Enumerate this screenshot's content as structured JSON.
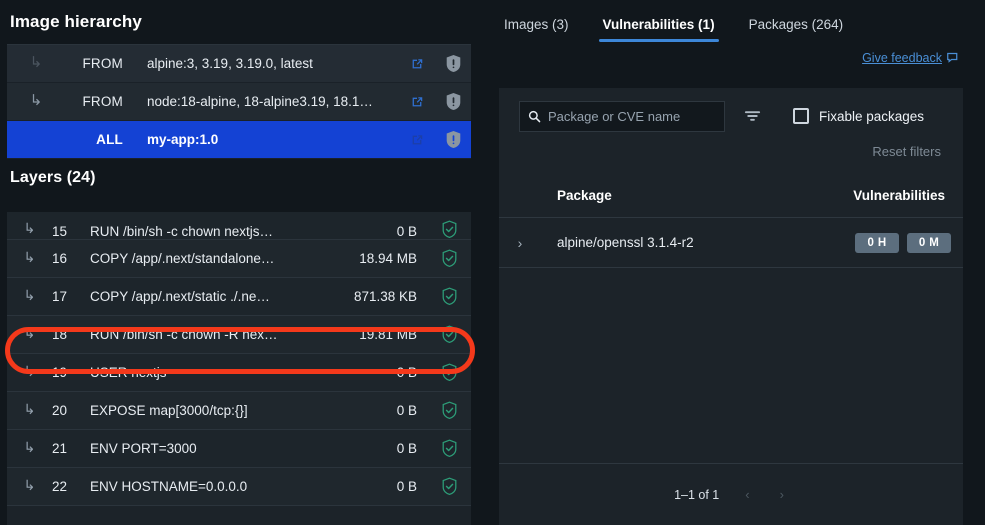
{
  "left": {
    "hierarchy_title": "Image hierarchy",
    "hierarchy_rows": [
      {
        "arrow": "corner-arrow",
        "keyword": "FROM",
        "name": "alpine:3, 3.19, 3.19.0, latest",
        "link_icon": "external-link-icon",
        "status_icon": "shield-warning-icon",
        "selected": false
      },
      {
        "arrow": "corner-arrow",
        "keyword": "FROM",
        "name": "node:18-alpine, 18-alpine3.19, 18.1…",
        "link_icon": "external-link-icon",
        "status_icon": "shield-warning-icon",
        "selected": false
      },
      {
        "arrow": "",
        "keyword": "ALL",
        "name": "my-app:1.0",
        "link_icon": "external-link-icon",
        "status_icon": "shield-warning-icon",
        "selected": true
      }
    ],
    "layers_title": "Layers (24)",
    "layers": [
      {
        "num": "15",
        "command": "RUN /bin/sh -c chown nextjs…",
        "size": "0 B",
        "status_icon": "shield-check-icon"
      },
      {
        "num": "16",
        "command": "COPY /app/.next/standalone…",
        "size": "18.94 MB",
        "status_icon": "shield-check-icon"
      },
      {
        "num": "17",
        "command": "COPY /app/.next/static ./.ne…",
        "size": "871.38 KB",
        "status_icon": "shield-check-icon"
      },
      {
        "num": "18",
        "command": "RUN /bin/sh -c chown -R nex…",
        "size": "19.81 MB",
        "status_icon": "shield-check-icon"
      },
      {
        "num": "19",
        "command": "USER nextjs",
        "size": "0 B",
        "status_icon": "shield-check-icon"
      },
      {
        "num": "20",
        "command": "EXPOSE map[3000/tcp:{}]",
        "size": "0 B",
        "status_icon": "shield-check-icon"
      },
      {
        "num": "21",
        "command": "ENV PORT=3000",
        "size": "0 B",
        "status_icon": "shield-check-icon"
      },
      {
        "num": "22",
        "command": "ENV HOSTNAME=0.0.0.0",
        "size": "0 B",
        "status_icon": "shield-check-icon"
      }
    ],
    "highlight_color": "#f4391b"
  },
  "right": {
    "tabs": [
      {
        "label": "Images (3)",
        "active": false
      },
      {
        "label": "Vulnerabilities (1)",
        "active": true
      },
      {
        "label": "Packages (264)",
        "active": false
      }
    ],
    "feedback_label": "Give feedback",
    "feedback_icon": "feedback-message-icon",
    "search_placeholder": "Package or CVE name",
    "search_value": "",
    "search_icon": "search-icon",
    "filter_icon": "filter-funnel-icon",
    "fixable_label": "Fixable packages",
    "fixable_checked": false,
    "reset_label": "Reset filters",
    "columns": {
      "package": "Package",
      "vulnerabilities": "Vulnerabilities"
    },
    "rows": [
      {
        "expand_icon": "chevron-right-icon",
        "package": "alpine/openssl 3.1.4-r2",
        "badges": [
          {
            "label": "0 H"
          },
          {
            "label": "0 M"
          }
        ]
      }
    ],
    "pagination": {
      "range": "1–1 of 1",
      "prev": "‹",
      "next": "›"
    },
    "accent_color": "#3d87d8",
    "badge_color": "#5c6e7e"
  }
}
